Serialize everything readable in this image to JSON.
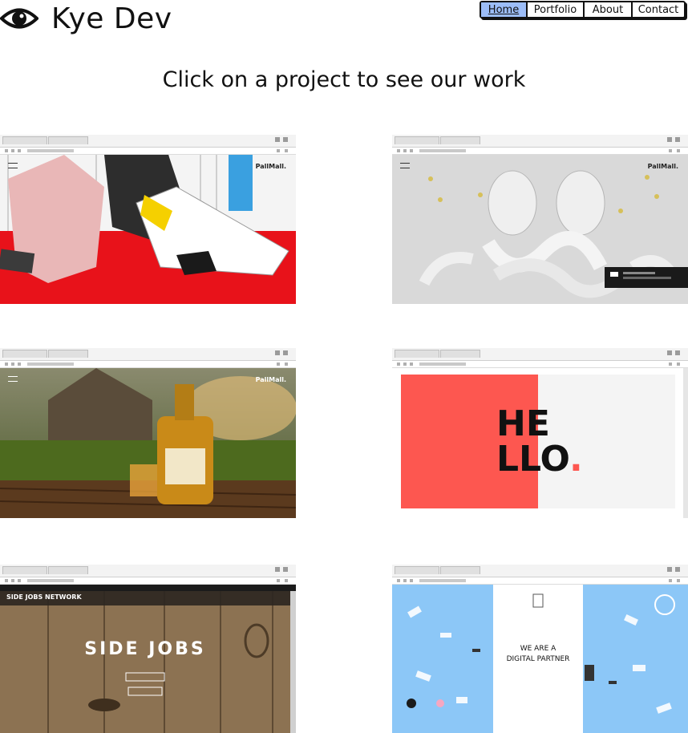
{
  "header": {
    "logo_text": "Kye Dev",
    "logo_icon": "eye-icon",
    "nav": [
      {
        "label": "Home",
        "active": true
      },
      {
        "label": "Portfolio",
        "active": false
      },
      {
        "label": "About",
        "active": false
      },
      {
        "label": "Contact",
        "active": false
      }
    ]
  },
  "main": {
    "headline": "Click on a project to see our work",
    "projects": [
      {
        "id": "pallmall-illustration",
        "brand": "PallMall."
      },
      {
        "id": "pallmall-sculpture",
        "brand": "PallMall."
      },
      {
        "id": "pallmall-honey",
        "brand": "PallMall."
      },
      {
        "id": "hello-agency",
        "hello_line1": "HE",
        "hello_line2": "LLO",
        "dot": "."
      },
      {
        "id": "side-jobs",
        "site_title": "SIDE JOBS NETWORK",
        "hero_title": "SIDE JOBS"
      },
      {
        "id": "digital-partner",
        "line1": "WE ARE A",
        "line2": "DIGITAL PARTNER"
      }
    ]
  },
  "colors": {
    "nav_active": "#9cbdf8",
    "hello_red": "#fd5750",
    "sky_blue": "#8cc7f7",
    "illustration_red": "#e8121a"
  }
}
